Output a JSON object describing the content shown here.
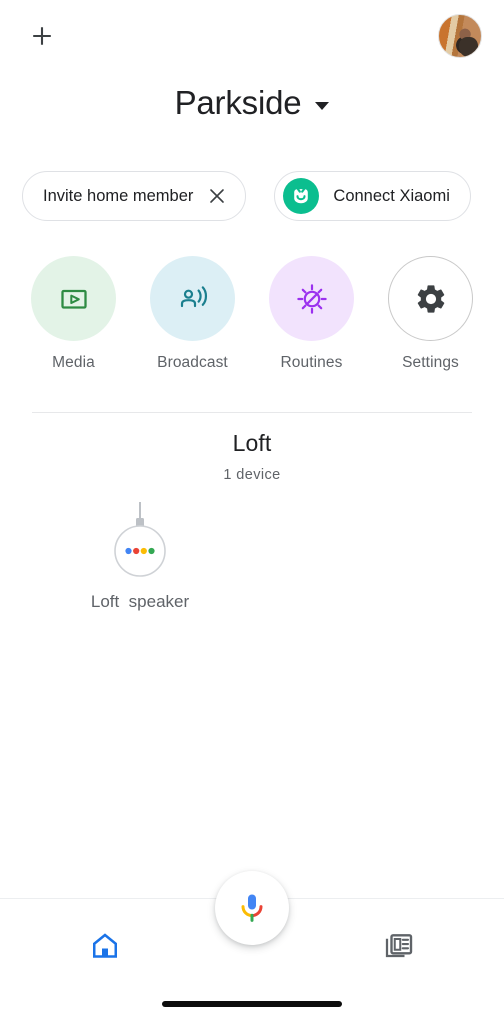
{
  "topbar": {
    "add_label": "+",
    "add_icon": "plus-icon",
    "avatar_label": "account-avatar"
  },
  "header": {
    "home_name": "Parkside",
    "dropdown_icon": "chevron-down-icon"
  },
  "chips": [
    {
      "label": "Invite home member",
      "trailing_icon": "close-icon",
      "leading_icon": ""
    },
    {
      "label": "Connect Xiaomi",
      "trailing_icon": "",
      "leading_icon": "mi-home-logo-icon"
    }
  ],
  "quick_actions": [
    {
      "label": "Media",
      "icon": "media-play-icon",
      "bubble_color": "#e3f3e7",
      "icon_color": "#2e8b43"
    },
    {
      "label": "Broadcast",
      "icon": "broadcast-icon",
      "bubble_color": "#dceff5",
      "icon_color": "#1a7f8e"
    },
    {
      "label": "Routines",
      "icon": "routines-sun-icon",
      "bubble_color": "#f2e3fd",
      "icon_color": "#9b30ef"
    },
    {
      "label": "Settings",
      "icon": "gear-icon",
      "bubble_color": "#ffffff",
      "icon_color": "#3c4043"
    }
  ],
  "room": {
    "name": "Loft",
    "device_count_text": "1 device",
    "devices": [
      {
        "label": "Loft  speaker",
        "icon": "hanging-speaker-icon"
      }
    ]
  },
  "bottom_nav": {
    "items": [
      {
        "label": "Home",
        "icon": "home-icon",
        "active": true,
        "color": "#1a73e8"
      },
      {
        "label": "Feed",
        "icon": "feed-icon",
        "active": false,
        "color": "#5f6368"
      }
    ],
    "assistant": {
      "label": "Google Assistant",
      "icon": "assistant-mic-icon"
    }
  },
  "colors": {
    "google_blue": "#4285F4",
    "google_red": "#EA4335",
    "google_yellow": "#FBBC04",
    "google_green": "#34A853",
    "mi_teal": "#0BBE8F",
    "nav_active": "#1a73e8",
    "text_primary": "#202124",
    "text_secondary": "#5f6368"
  }
}
